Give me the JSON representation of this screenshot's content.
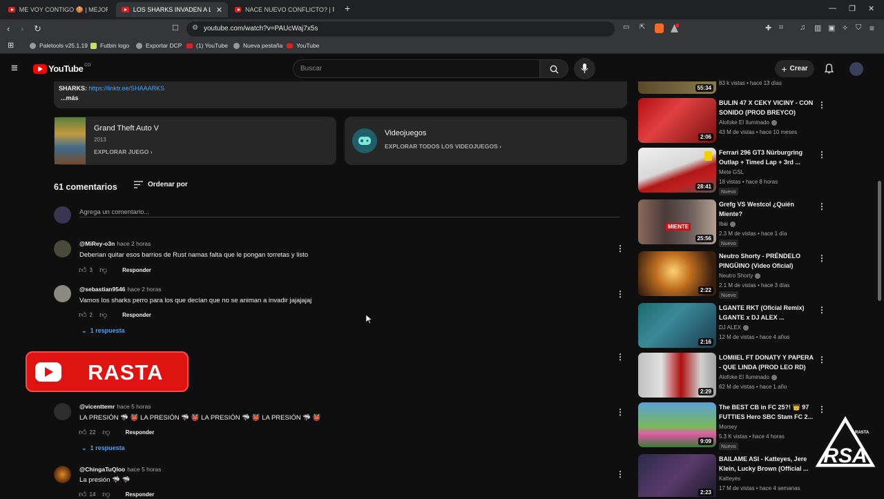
{
  "browser": {
    "tabs": [
      {
        "title": "ME VOY CONTIGO 🍪 | MEJORES"
      },
      {
        "title": "LOS SHARKS INVADEN A LA CM"
      },
      {
        "title": "NACE NUEVO CONFLICTO? | FAMILY"
      }
    ],
    "url": "youtube.com/watch?v=PAUcWaj7x5s",
    "bookmarks": [
      "Paletools v25.1.19",
      "Futbin logo",
      "Exportar DCP",
      "(1) YouTube",
      "Nueva pestaña",
      "YouTube"
    ]
  },
  "youtube": {
    "logo_text": "YouTube",
    "country_code": "CO",
    "search_placeholder": "Buscar",
    "create_label": "Crear"
  },
  "description": {
    "sharks_label": "SHARKS:",
    "link": "https://linktr.ee/SHAAARKS",
    "more": "...más"
  },
  "cards": [
    {
      "title": "Grand Theft Auto V",
      "year": "2013",
      "action": "EXPLORAR JUEGO"
    },
    {
      "title": "Videojuegos",
      "action": "EXPLORAR TODOS LOS VIDEOJUEGOS"
    }
  ],
  "comments_header": {
    "count": "61 comentarios",
    "sort": "Ordenar por",
    "add_placeholder": "Agrega un comentario..."
  },
  "comments": [
    {
      "author": "@MiRey-o3n",
      "time": "hace 2 horas",
      "text": "Deberian quitar esos barrios de Rust namas falta que le pongan torretas y listo",
      "likes": "3",
      "reply": "Responder"
    },
    {
      "author": "@sebastian9546",
      "time": "hace 2 horas",
      "text": "Vamos los sharks perro para los que decían que no se animan a invadir jajajajaj",
      "likes": "2",
      "reply": "Responder",
      "replies": "1 respuesta"
    },
    {
      "author": "@vicenttemr",
      "time": "hace 5 horas",
      "text": "LA PRESIÓN 🦈 👹 LA PRESIÓN 🦈 👹 LA PRESIÓN 🦈 👹 LA PRESIÓN 🦈 👹",
      "likes": "22",
      "reply": "Responder",
      "replies": "1 respuesta"
    },
    {
      "author": "@ChingaTuQloo",
      "time": "hace 5 horas",
      "text": "La presión 🦈 🦈",
      "likes": "14",
      "reply": "Responder"
    }
  ],
  "overlay": {
    "rasta_label": "RASTA",
    "corner_logo_text": "RASTA"
  },
  "sidebar": {
    "partial_meta": "83 k vistas • hace 13 días",
    "partial_duration": "55:34",
    "videos": [
      {
        "title": "BULIN 47 X CEKY VICINY - CON SONIDO (PROD BREYCO)",
        "channel": "Alofoke El Iluminado",
        "meta": "43 M de vistas • hace 10 meses",
        "duration": "2:06",
        "verified": true
      },
      {
        "title": "Ferrari 296 GT3 Nürburgring Outlap + Timed Lap + 3rd ...",
        "channel": "Mete GSL",
        "meta": "18 vistas • hace 8 horas",
        "duration": "28:41",
        "nuevo": "Nuevo"
      },
      {
        "title": "Grefg VS Westcol ¿Quién Miente?",
        "channel": "Ibai",
        "meta": "2.3 M de vistas • hace 1 día",
        "duration": "25:56",
        "nuevo": "Nuevo",
        "verified": true,
        "thumb_text": "MIENTE"
      },
      {
        "title": "Neutro Shorty - PRÉNDELO PINGÜINO (Video Oficial)",
        "channel": "Neutro Shorty",
        "meta": "2.1 M de vistas • hace 3 días",
        "duration": "2:22",
        "nuevo": "Nuevo",
        "verified": true
      },
      {
        "title": "LGANTE RKT (Oficial Remix) LGANTE x DJ ALEX ...",
        "channel": "DJ ALEX",
        "meta": "12 M de vistas • hace 4 años",
        "duration": "2:16",
        "verified": true
      },
      {
        "title": "LOMIIEL FT DONATY Y PAPERA - QUE LINDA (PROD LEO RD)",
        "channel": "Alofoke El Iluminado",
        "meta": "62 M de vistas • hace 1 año",
        "duration": "2:29",
        "verified": true
      },
      {
        "title": "The BEST CB in FC 25?! 👑 97 FUTTIES Hero SBC Stam FC 2...",
        "channel": "Morsey",
        "meta": "5.3 K vistas • hace 4 horas",
        "duration": "9:09",
        "nuevo": "Nuevo"
      },
      {
        "title": "BAILAME ASI - Katteyes, Jere Klein, Lucky Brown (Official ...",
        "channel": "Katteyes",
        "meta": "17 M de vistas • hace 4 semanas",
        "duration": "2:23"
      }
    ]
  }
}
